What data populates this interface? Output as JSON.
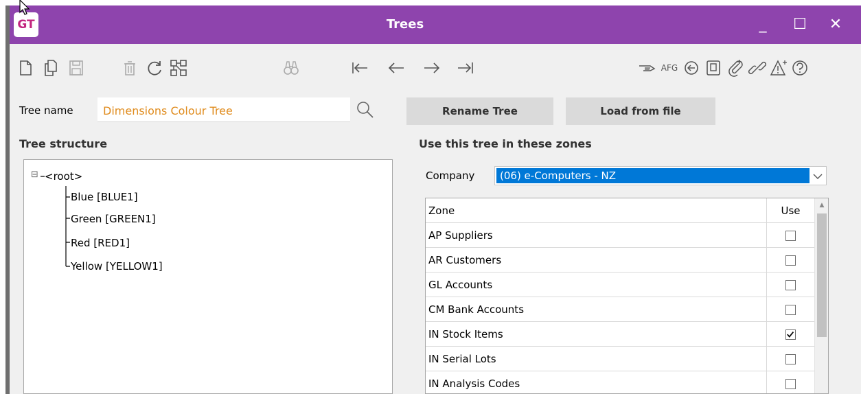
{
  "window": {
    "title": "Trees",
    "logo": "GT",
    "minimize_glyph": "_",
    "maximize_glyph": "☐",
    "close_glyph": "✕"
  },
  "toolbar": {
    "afg_label": "AFG",
    "icons": [
      "new-document-icon",
      "copy-document-icon",
      "save-icon",
      "delete-icon",
      "refresh-icon",
      "tree-structure-icon",
      "binoculars-icon",
      "first-record-icon",
      "previous-record-icon",
      "next-record-icon",
      "last-record-icon",
      "pointer-hand-icon",
      "back-circle-icon",
      "clipboard-icon",
      "attach-icon",
      "link-icon",
      "alert-icon",
      "help-icon"
    ]
  },
  "form": {
    "tree_name_label": "Tree name",
    "tree_name_value": "Dimensions Colour Tree",
    "rename_button": "Rename Tree",
    "load_button": "Load from file"
  },
  "tree": {
    "section_title": "Tree structure",
    "collapse_glyph": "⊟",
    "root": "<root>",
    "children": [
      "Blue [BLUE1]",
      "Green [GREEN1]",
      "Red [RED1]",
      "Yellow [YELLOW1]"
    ]
  },
  "zones": {
    "section_title": "Use this tree in these zones",
    "company_label": "Company",
    "company_value": "(06) e-Computers - NZ",
    "columns": [
      "Zone",
      "Use"
    ],
    "rows": [
      {
        "zone": "AP Suppliers",
        "use": false
      },
      {
        "zone": "AR Customers",
        "use": false
      },
      {
        "zone": "GL Accounts",
        "use": false
      },
      {
        "zone": "CM Bank Accounts",
        "use": false
      },
      {
        "zone": "IN Stock Items",
        "use": true
      },
      {
        "zone": "IN Serial Lots",
        "use": false
      },
      {
        "zone": "IN Analysis Codes",
        "use": false
      }
    ]
  },
  "colors": {
    "titlebar": "#8e44ad",
    "selection": "#0078d7",
    "tree_name_text": "#e08c1e"
  }
}
